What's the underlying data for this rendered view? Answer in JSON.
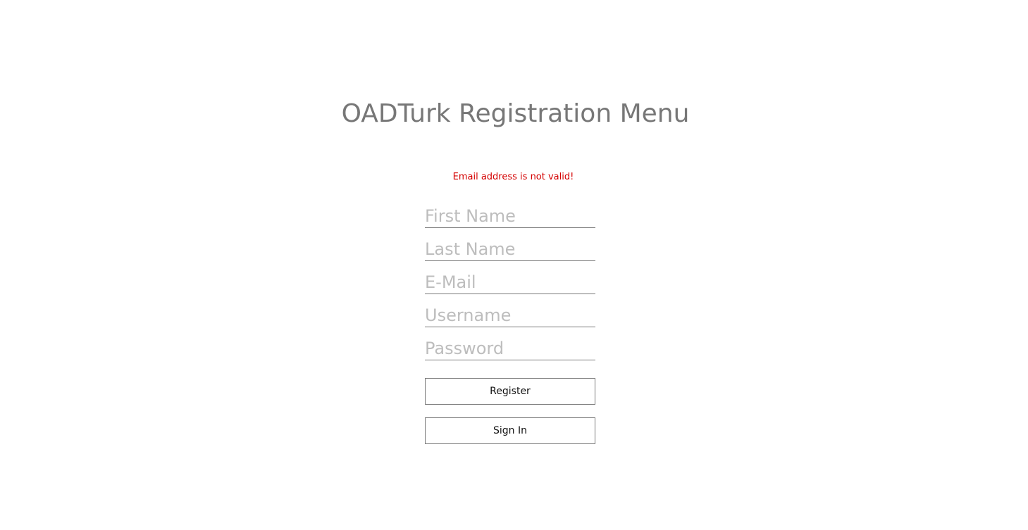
{
  "page": {
    "title": "OADTurk Registration Menu",
    "error_message": "Email address is not valid!"
  },
  "form": {
    "first_name": {
      "placeholder": "First Name",
      "value": ""
    },
    "last_name": {
      "placeholder": "Last Name",
      "value": ""
    },
    "email": {
      "placeholder": "E-Mail",
      "value": ""
    },
    "username": {
      "placeholder": "Username",
      "value": ""
    },
    "password": {
      "placeholder": "Password",
      "value": ""
    }
  },
  "buttons": {
    "register_label": "Register",
    "signin_label": "Sign In"
  },
  "colors": {
    "title": "#777777",
    "error": "#d40000",
    "placeholder": "#bdbdbd",
    "border": "#7a7a7a"
  }
}
